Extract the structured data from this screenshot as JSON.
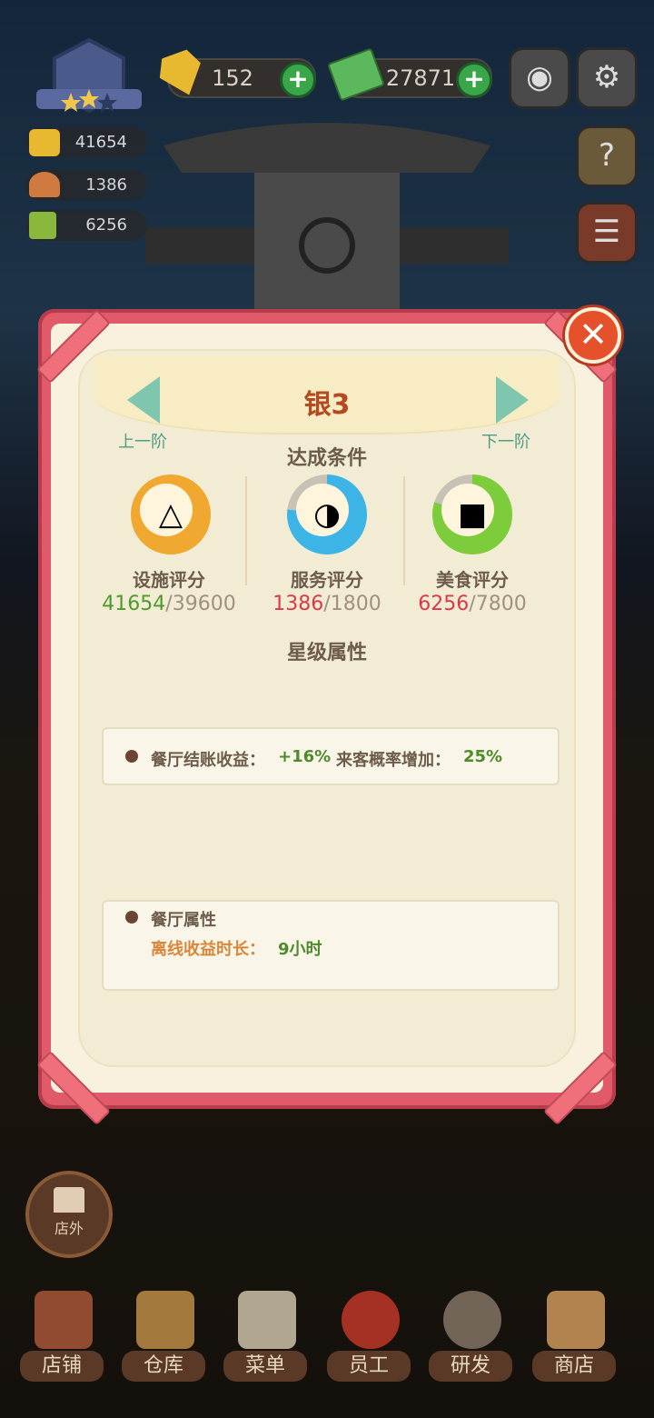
{
  "hud": {
    "gems": "152",
    "cash": "27871",
    "facility_score": "41654",
    "service_score": "1386",
    "food_score": "6256",
    "camera_icon": "camera-icon",
    "settings_icon": "gear-icon",
    "guide_icon": "book-question-icon"
  },
  "modal": {
    "title": "银3",
    "prev_label": "上一阶",
    "next_label": "下一阶",
    "conditions_heading": "达成条件",
    "criteria": [
      {
        "label": "设施评分",
        "current": "41654",
        "target": "/39600",
        "progress": 1.0,
        "ring_color": "#f0a830",
        "met": true
      },
      {
        "label": "服务评分",
        "current": "1386",
        "target": "/1800",
        "progress": 0.77,
        "ring_color": "#3cb4e6",
        "met": false
      },
      {
        "label": "美食评分",
        "current": "6256",
        "target": "/7800",
        "progress": 0.8,
        "ring_color": "#7ccc3c",
        "met": false
      }
    ],
    "star_heading": "星级属性",
    "star_attr_1": "餐厅结账收益：",
    "star_attr_1_val": "+16%",
    "star_attr_2": "来客概率增加：",
    "star_attr_2_val": "25%",
    "restaurant_heading": "餐厅属性",
    "offline_label": "离线收益时长：",
    "offline_val": "9小时"
  },
  "outside_label": "店外",
  "nav": [
    "店铺",
    "仓库",
    "菜单",
    "员工",
    "研发",
    "商店"
  ],
  "colors": {
    "met": "#4f9a2c",
    "unmet": "#d83a4a",
    "target": "#a09080",
    "accent": "#b34a20"
  }
}
